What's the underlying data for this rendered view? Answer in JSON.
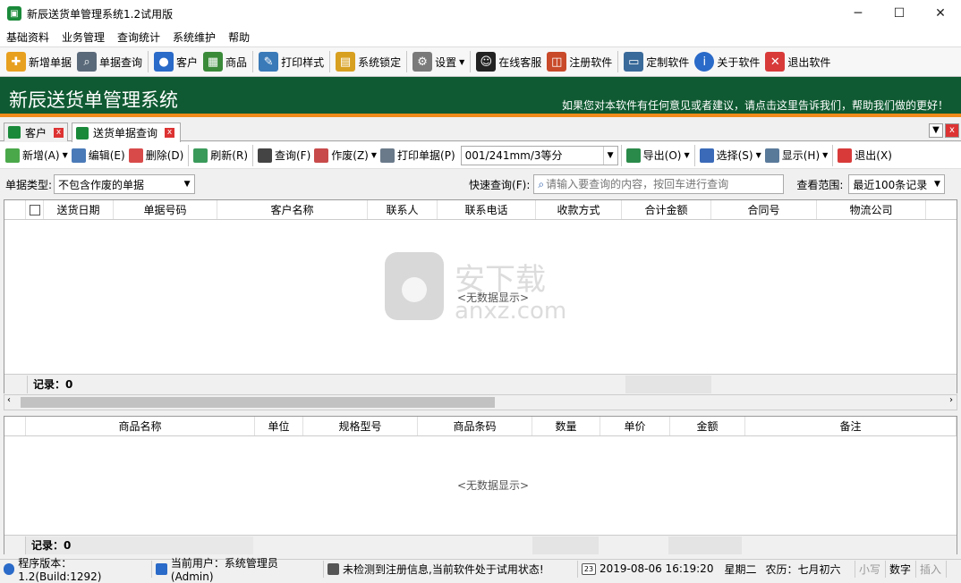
{
  "window": {
    "title": "新辰送货单管理系统1.2试用版",
    "minimize": "─",
    "maximize": "☐",
    "close": "✕"
  },
  "menu": [
    "基础资料",
    "业务管理",
    "查询统计",
    "系统维护",
    "帮助"
  ],
  "toolbar": [
    {
      "label": "新增单据",
      "icon": "new-doc-icon",
      "color": "#e8a020"
    },
    {
      "label": "单据查询",
      "icon": "doc-search-icon",
      "color": "#5a6a7a"
    },
    {
      "label": "客户",
      "icon": "users-icon",
      "color": "#2a6ac8"
    },
    {
      "label": "商品",
      "icon": "grid-icon",
      "color": "#3a8a3a"
    },
    {
      "label": "打印样式",
      "icon": "print-style-icon",
      "color": "#3a7ab8"
    },
    {
      "label": "系统锁定",
      "icon": "lock-icon",
      "color": "#d8a020"
    },
    {
      "label": "设置",
      "icon": "gear-icon",
      "color": "#7a7a7a"
    },
    {
      "label": "在线客服",
      "icon": "qq-icon",
      "color": "#222"
    },
    {
      "label": "注册软件",
      "icon": "basket-icon",
      "color": "#c84a2a"
    },
    {
      "label": "定制软件",
      "icon": "window-icon",
      "color": "#3a6a9a"
    },
    {
      "label": "关于软件",
      "icon": "info-icon",
      "color": "#2a6ac8"
    },
    {
      "label": "退出软件",
      "icon": "exit-icon",
      "color": "#d83a3a"
    }
  ],
  "banner": {
    "title": "新辰送货单管理系统",
    "message": "如果您对本软件有任何意见或者建议，请点击这里告诉我们，帮助我们做的更好！"
  },
  "tabs": [
    {
      "label": "客户"
    },
    {
      "label": "送货单据查询"
    }
  ],
  "subtoolbar": {
    "new": "新增(A)",
    "edit": "编辑(E)",
    "delete": "删除(D)",
    "refresh": "刷新(R)",
    "query": "查询(F)",
    "void": "作废(Z)",
    "print": "打印单据(P)",
    "paper": "001/241mm/3等分",
    "export": "导出(O)",
    "select": "选择(S)",
    "display": "显示(H)",
    "exit": "退出(X)"
  },
  "filter": {
    "type_label": "单据类型:",
    "type_value": "不包含作废的单据",
    "quick_label": "快速查询(F):",
    "quick_placeholder": "请输入要查询的内容，按回车进行查询",
    "range_label": "查看范围:",
    "range_value": "最近100条记录"
  },
  "grid1": {
    "columns": [
      "送货日期",
      "单据号码",
      "客户名称",
      "联系人",
      "联系电话",
      "收款方式",
      "合计金额",
      "合同号",
      "物流公司"
    ],
    "empty": "<无数据显示>",
    "footer": "记录：0"
  },
  "grid2": {
    "columns": [
      "商品名称",
      "单位",
      "规格型号",
      "商品条码",
      "数量",
      "单价",
      "金额",
      "备注"
    ],
    "empty": "<无数据显示>",
    "footer": "记录：0"
  },
  "watermark": {
    "text": "安下载",
    "sub": "anxz.com"
  },
  "status": {
    "version": "程序版本：1.2(Build:1292)",
    "user": "当前用户：系统管理员(Admin)",
    "reg": "未检测到注册信息,当前软件处于试用状态!",
    "datetime": "2019-08-06 16:19:20",
    "weekday": "星期二",
    "lunar": "农历：七月初六",
    "caps": "小写",
    "num": "数字",
    "ins": "插入",
    "cal_day": "23"
  }
}
